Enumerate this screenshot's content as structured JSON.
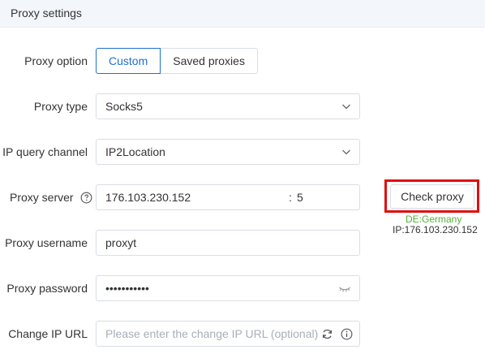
{
  "header": {
    "title": "Proxy settings"
  },
  "form": {
    "proxy_option": {
      "label": "Proxy option",
      "options": [
        "Custom",
        "Saved proxies"
      ],
      "selected": "Custom"
    },
    "proxy_type": {
      "label": "Proxy type",
      "value": "Socks5"
    },
    "ip_query_channel": {
      "label": "IP query channel",
      "value": "IP2Location"
    },
    "proxy_server": {
      "label": "Proxy server",
      "host": "176.103.230.152",
      "separator": ":",
      "port": "5"
    },
    "proxy_username": {
      "label": "Proxy username",
      "value": "proxyt"
    },
    "proxy_password": {
      "label": "Proxy password",
      "value": "•••••••••••"
    },
    "change_ip_url": {
      "label": "Change IP URL",
      "placeholder": "Please enter the change IP URL (optional)"
    }
  },
  "check": {
    "button_label": "Check proxy",
    "result_location": "DE:Germany",
    "result_ip": "IP:176.103.230.152"
  },
  "colors": {
    "accent": "#1f6fd1",
    "highlight": "#e01010",
    "success": "#52b13a",
    "header_bg": "#f3f6fb"
  }
}
